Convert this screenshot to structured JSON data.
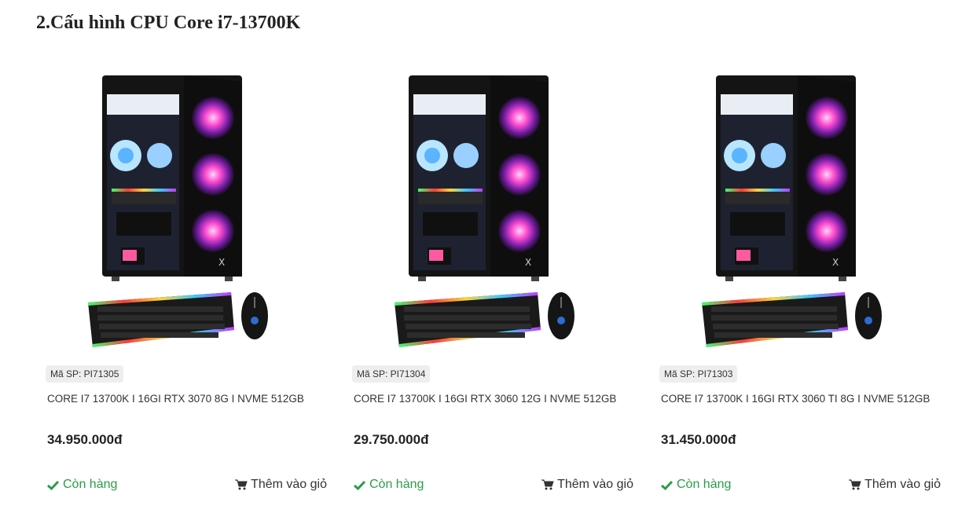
{
  "section": {
    "title": "2.Cấu hình CPU Core i7-13700K"
  },
  "colors": {
    "in_stock": "#2a9d48",
    "price": "#222222",
    "badge_bg": "#eeeeee"
  },
  "products": [
    {
      "sku": "Mã SP: PI71305",
      "name": "CORE I7 13700K I 16GI RTX 3070 8G I NVME 512GB",
      "price": "34.950.000đ",
      "stock": "Còn hàng",
      "cart_label": "Thêm vào giỏ",
      "stock_icon": "check-icon",
      "cart_icon": "shopping-cart-icon"
    },
    {
      "sku": "Mã SP: PI71304",
      "name": "CORE I7 13700K I 16GI RTX 3060 12G I NVME 512GB",
      "price": "29.750.000đ",
      "stock": "Còn hàng",
      "cart_label": "Thêm vào giỏ",
      "stock_icon": "check-icon",
      "cart_icon": "shopping-cart-icon"
    },
    {
      "sku": "Mã SP: PI71303",
      "name": "CORE I7 13700K I 16GI RTX 3060 TI 8G I NVME 512GB",
      "price": "31.450.000đ",
      "stock": "Còn hàng",
      "cart_label": "Thêm vào giỏ",
      "stock_icon": "check-icon",
      "cart_icon": "shopping-cart-icon"
    }
  ]
}
